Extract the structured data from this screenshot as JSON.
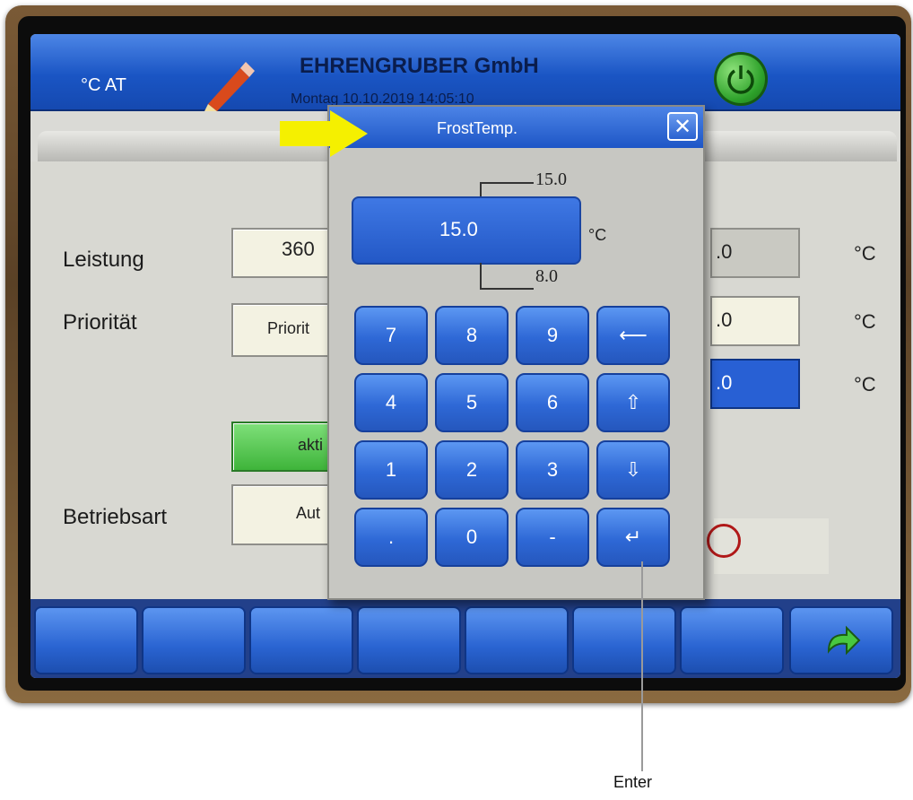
{
  "header": {
    "unit_label": "°C AT",
    "company": "EHRENGRUBER GmbH",
    "datetime": "Montag    10.10.2019   14:05:10"
  },
  "main": {
    "leistung_label": "Leistung",
    "leistung_value": "360",
    "prioritaet_label": "Priorität",
    "prioritaet_value": "Priorit",
    "aktiv_value": "akti",
    "betriebsart_label": "Betriebsart",
    "betriebsart_value": "Aut",
    "temp_fields": [
      {
        "value": ".0",
        "unit": "°C",
        "bg": "#c9c9c2"
      },
      {
        "value": ".0",
        "unit": "°C",
        "bg": "#f3f2e2"
      },
      {
        "value": ".0",
        "unit": "°C",
        "bg": "#2860d4"
      }
    ]
  },
  "dialog": {
    "title": "FrostTemp.",
    "close_label": "✕",
    "value": "15.0",
    "unit": "°C",
    "range_max": "15.0",
    "range_min": "8.0",
    "keys": [
      {
        "label": "7",
        "name": "key-7"
      },
      {
        "label": "8",
        "name": "key-8"
      },
      {
        "label": "9",
        "name": "key-9"
      },
      {
        "label": "⟵",
        "name": "key-backspace"
      },
      {
        "label": "4",
        "name": "key-4"
      },
      {
        "label": "5",
        "name": "key-5"
      },
      {
        "label": "6",
        "name": "key-6"
      },
      {
        "label": "⇧",
        "name": "key-up"
      },
      {
        "label": "1",
        "name": "key-1"
      },
      {
        "label": "2",
        "name": "key-2"
      },
      {
        "label": "3",
        "name": "key-3"
      },
      {
        "label": "⇩",
        "name": "key-down"
      },
      {
        "label": ".",
        "name": "key-decimal"
      },
      {
        "label": "0",
        "name": "key-0"
      },
      {
        "label": "-",
        "name": "key-minus"
      },
      {
        "label": "↵",
        "name": "key-enter"
      }
    ]
  },
  "annotations": {
    "enter_callout": "Enter",
    "arrow_color": "#f5f000"
  },
  "icons": {
    "pencil": "pencil-icon",
    "power": "power-icon",
    "back": "back-arrow-icon"
  }
}
